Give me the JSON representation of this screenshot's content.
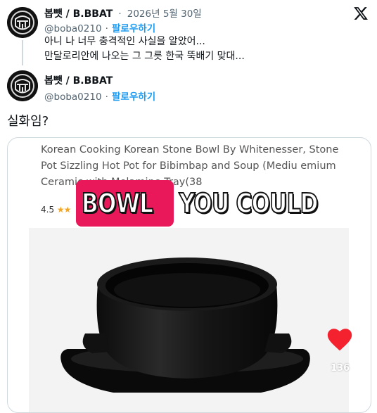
{
  "tweet1": {
    "display_name": "봅뺏 / B.BBAT",
    "separator": "·",
    "date": "2026년 5월 30일",
    "handle": "@boba0210",
    "follow_label": "팔로우하기",
    "text_line1": "아니 나 너무 충격적인 사실을 알았어...",
    "text_line2": "만달로리안에 나오는 그 그릇 한국 뚝배기 맞대..."
  },
  "tweet2": {
    "display_name": "봅뺏 / B.BBAT",
    "handle": "@boba0210",
    "follow_label": "팔로우하기",
    "text": "실화임?"
  },
  "media": {
    "product_title": "Korean Cooking Korean Stone Bowl By Whitenesser, Stone Pot Sizzling Hot Pot for Bibimbap and Soup (Mediu      emium Ceramic with Melamine Tray(38",
    "rating_value": "4.5",
    "rating_stars": "★★",
    "caption_highlight": "BOWL",
    "caption_rest": "YOU COULD",
    "like_count": "136"
  },
  "icons": {
    "x_logo": "x-logo-icon",
    "heart": "heart-icon"
  },
  "colors": {
    "link_blue": "#1d9bf0",
    "caption_pink": "#e8185a",
    "heart_red": "#f4212e"
  }
}
